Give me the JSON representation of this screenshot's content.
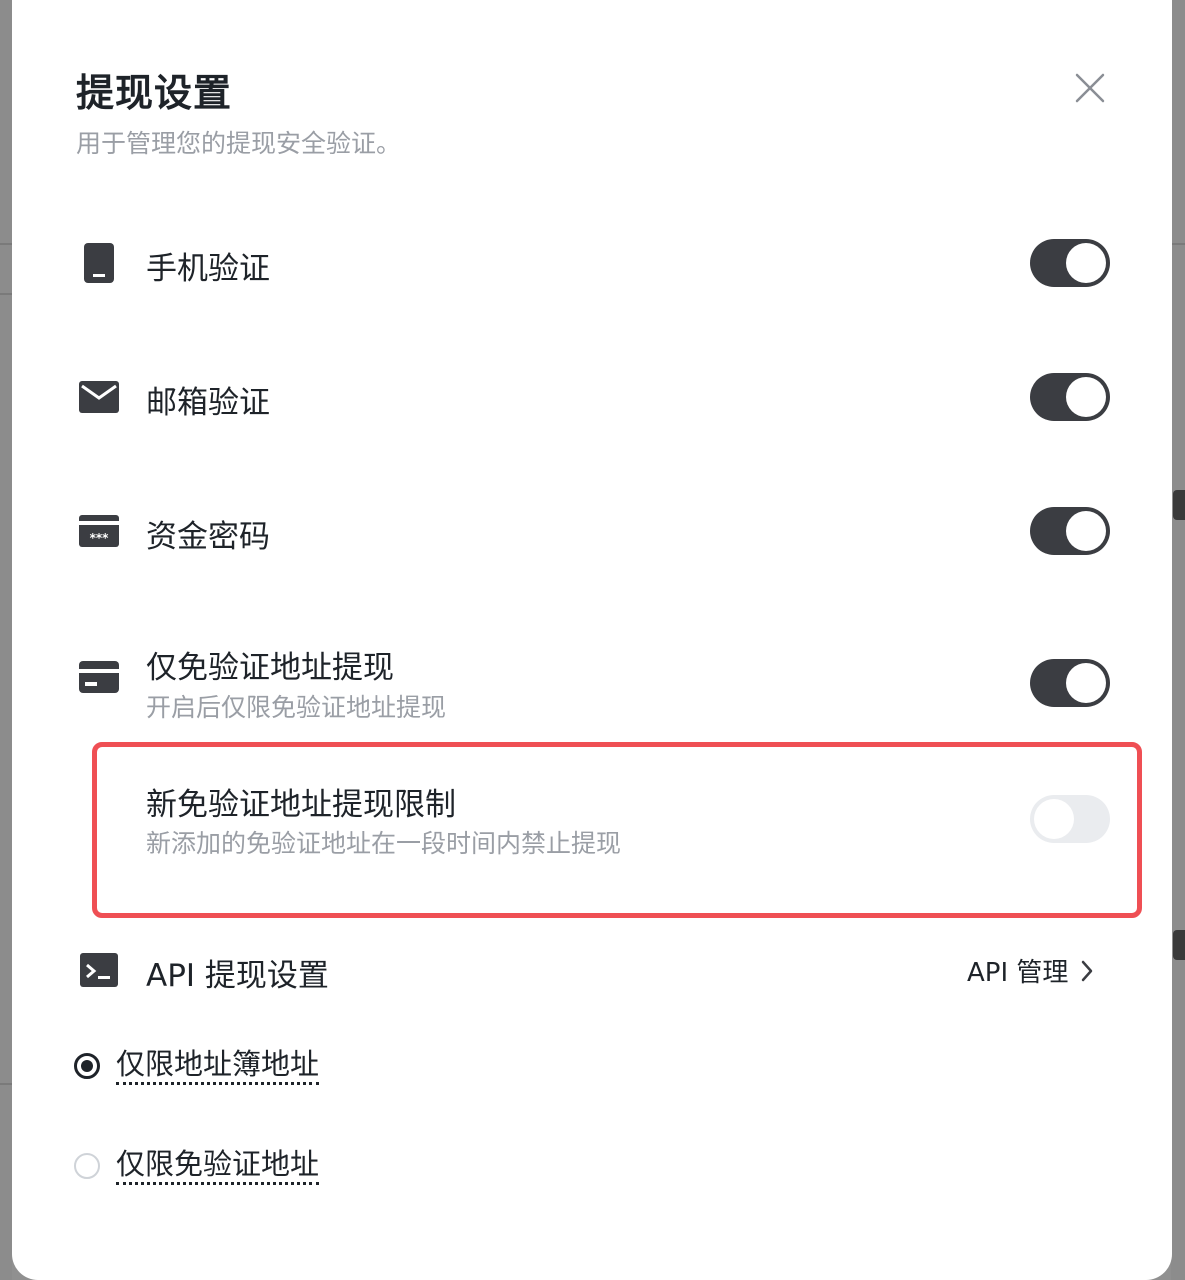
{
  "modal": {
    "title": "提现设置",
    "subtitle": "用于管理您的提现安全验证。",
    "close_icon": "close-icon"
  },
  "settings": [
    {
      "label": "手机验证",
      "icon": "phone-icon",
      "enabled": true
    },
    {
      "label": "邮箱验证",
      "icon": "mail-icon",
      "enabled": true
    },
    {
      "label": "资金密码",
      "icon": "password-card-icon",
      "enabled": true
    },
    {
      "label": "仅免验证地址提现",
      "desc": "开启后仅限免验证地址提现",
      "icon": "card-icon",
      "enabled": true
    },
    {
      "label": "新免验证地址提现限制",
      "desc": "新添加的免验证地址在一段时间内禁止提现",
      "enabled": false,
      "highlight_color": "#ef4f54"
    }
  ],
  "api": {
    "label": "API 提现设置",
    "icon": "terminal-icon",
    "link_label": "API 管理"
  },
  "radio_options": [
    {
      "label": "仅限地址簿地址",
      "checked": true
    },
    {
      "label": "仅限免验证地址",
      "checked": false
    }
  ],
  "colors": {
    "toggle_on": "#3b3d42",
    "toggle_off": "#eaecef",
    "text_primary": "#1e2329",
    "text_secondary": "#9a9ea5"
  }
}
